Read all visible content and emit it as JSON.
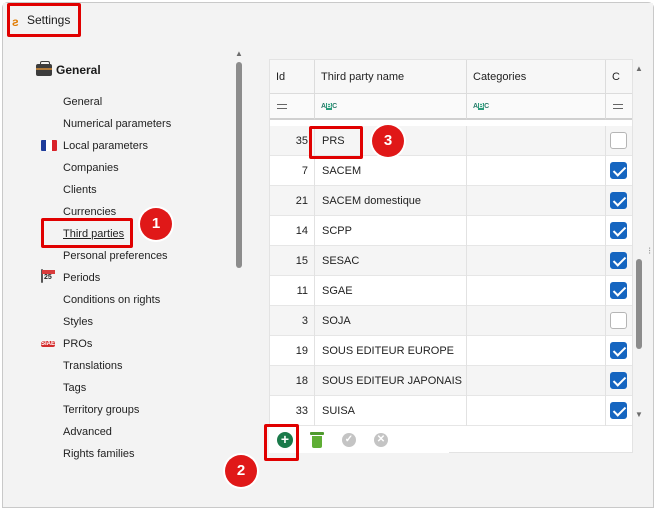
{
  "window": {
    "title": "Settings"
  },
  "sidebar": {
    "group_title": "General",
    "items": [
      {
        "label": "General",
        "icon": ""
      },
      {
        "label": "Numerical parameters",
        "icon": ""
      },
      {
        "label": "Local parameters",
        "icon": "french-flag-icon"
      },
      {
        "label": "Companies",
        "icon": ""
      },
      {
        "label": "Clients",
        "icon": ""
      },
      {
        "label": "Currencies",
        "icon": ""
      },
      {
        "label": "Third parties",
        "icon": "",
        "active": true
      },
      {
        "label": "Personal preferences",
        "icon": ""
      },
      {
        "label": "Periods",
        "icon": "calendar-icon"
      },
      {
        "label": "Conditions on rights",
        "icon": ""
      },
      {
        "label": "Styles",
        "icon": ""
      },
      {
        "label": "PROs",
        "icon": "pro-icon"
      },
      {
        "label": "Translations",
        "icon": ""
      },
      {
        "label": "Tags",
        "icon": ""
      },
      {
        "label": "Territory groups",
        "icon": ""
      },
      {
        "label": "Advanced",
        "icon": ""
      },
      {
        "label": "Rights families",
        "icon": ""
      }
    ],
    "calendar_icon_text": "25",
    "pro_icon_text": "SIAE"
  },
  "grid": {
    "columns": [
      "Id",
      "Third party name",
      "Categories",
      "C"
    ],
    "filter_icon_text": "ABC",
    "rows": [
      {
        "id": "35",
        "name": "PRS",
        "categories": "",
        "checked": false
      },
      {
        "id": "7",
        "name": "SACEM",
        "categories": "",
        "checked": true
      },
      {
        "id": "21",
        "name": "SACEM domestique",
        "categories": "",
        "checked": true
      },
      {
        "id": "14",
        "name": "SCPP",
        "categories": "",
        "checked": true
      },
      {
        "id": "15",
        "name": "SESAC",
        "categories": "",
        "checked": true
      },
      {
        "id": "11",
        "name": "SGAE",
        "categories": "",
        "checked": true
      },
      {
        "id": "3",
        "name": "SOJA",
        "categories": "",
        "checked": false
      },
      {
        "id": "19",
        "name": "SOUS EDITEUR EUROPE",
        "categories": "",
        "checked": true
      },
      {
        "id": "18",
        "name": "SOUS EDITEUR JAPONAIS",
        "categories": "",
        "checked": true
      },
      {
        "id": "33",
        "name": "SUISA",
        "categories": "",
        "checked": true
      }
    ]
  },
  "toolbar": {
    "add_label": "+",
    "confirm_label": "✓",
    "cancel_label": "✕"
  },
  "callouts": [
    "1",
    "2",
    "3"
  ],
  "colors": {
    "highlight": "#e00000",
    "checkbox_on": "#1565c0",
    "add_button": "#1a7a4a"
  }
}
